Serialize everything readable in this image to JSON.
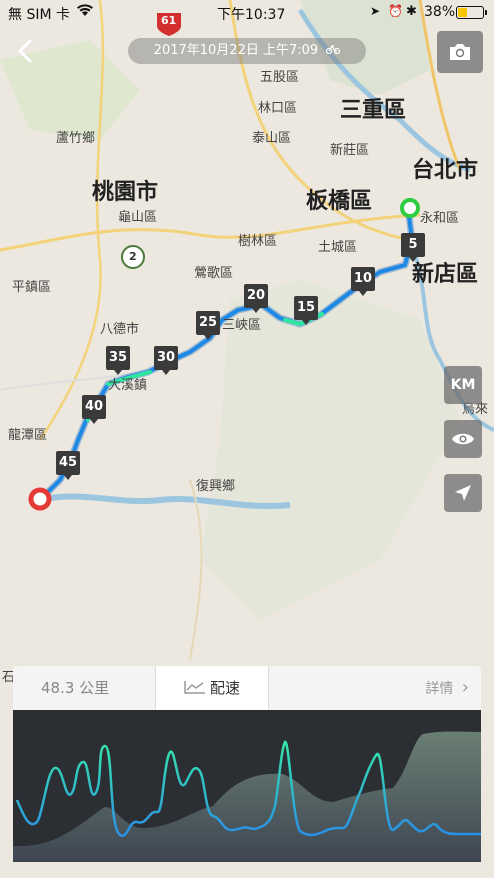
{
  "status_bar": {
    "carrier": "無 SIM 卡",
    "time": "下午10:37",
    "battery_percent": "38%",
    "battery_level": 0.38
  },
  "header": {
    "date_text": "2017年10月22日 上午7:09"
  },
  "map": {
    "labels": {
      "sanchong": "三重區",
      "taipei": "台北市",
      "banqiao": "板橋區",
      "xindian": "新店區",
      "taoyuan": "桃園市",
      "wugu": "五股區",
      "linkou": "林口區",
      "taishan": "泰山區",
      "xinzhuang": "新莊區",
      "luzhu": "蘆竹鄉",
      "guishan": "龜山區",
      "shulin": "樹林區",
      "tucheng": "土城區",
      "yonghe": "永和區",
      "yingge": "鶯歌區",
      "sanxia": "三峽區",
      "bade": "八德市",
      "daxi": "大溪鎮",
      "pingzhen": "平鎮區",
      "longtan": "龍潭區",
      "fuxing": "復興鄉",
      "wulai": "烏來",
      "shi": "石",
      "highway_61": "61",
      "route_2": "2"
    },
    "km_markers": [
      "5",
      "10",
      "15",
      "20",
      "25",
      "30",
      "35",
      "40",
      "45"
    ]
  },
  "controls": {
    "km_label": "KM"
  },
  "panel": {
    "distance_tab": "48.3 公里",
    "pace_tab": "配速",
    "details_label": "詳情"
  },
  "colors": {
    "route_blue": "#1e88e5",
    "route_green": "#2ee6a0",
    "start_green": "#2ecc40",
    "end_red": "#e53935"
  }
}
